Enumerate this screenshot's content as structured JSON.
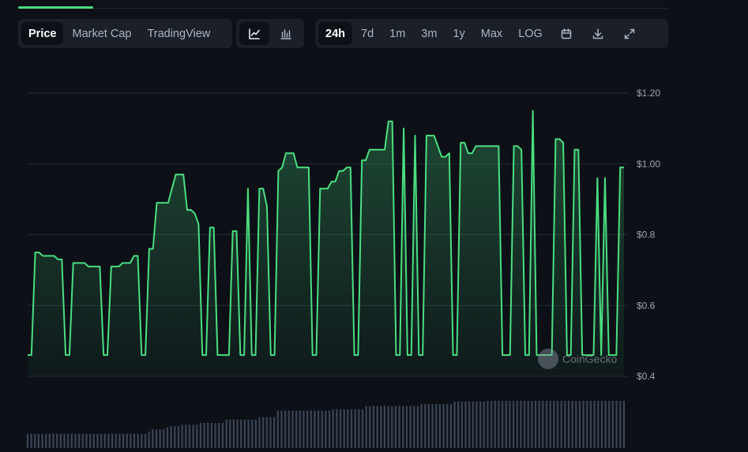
{
  "tabs": {
    "type": [
      {
        "label": "Price",
        "active": true
      },
      {
        "label": "Market Cap",
        "active": false
      },
      {
        "label": "TradingView",
        "active": false
      }
    ],
    "chart_icons": [
      {
        "icon": "line-chart-icon",
        "active": true
      },
      {
        "icon": "candlestick-chart-icon",
        "active": false
      }
    ],
    "ranges": [
      {
        "label": "24h",
        "active": true
      },
      {
        "label": "7d",
        "active": false
      },
      {
        "label": "1m",
        "active": false
      },
      {
        "label": "3m",
        "active": false
      },
      {
        "label": "1y",
        "active": false
      },
      {
        "label": "Max",
        "active": false
      },
      {
        "label": "LOG",
        "active": false
      }
    ],
    "tools": [
      "calendar-icon",
      "download-icon",
      "fullscreen-icon"
    ]
  },
  "watermark": "CoinGecko",
  "colors": {
    "accent": "#4ade80",
    "background": "#0d1117",
    "volume": "#3a4556"
  },
  "chart_data": {
    "type": "line",
    "title": "",
    "xlabel": "",
    "ylabel": "",
    "ylim": [
      0.4,
      1.2
    ],
    "y_ticks": [
      {
        "value": 1.2,
        "label": "$1.20"
      },
      {
        "value": 1.0,
        "label": "$1.00"
      },
      {
        "value": 0.8,
        "label": "$0.8"
      },
      {
        "value": 0.6,
        "label": "$0.6"
      },
      {
        "value": 0.4,
        "label": "$0.4"
      }
    ],
    "grid": true,
    "series": [
      {
        "values": [
          0.46,
          0.46,
          0.75,
          0.75,
          0.74,
          0.74,
          0.74,
          0.74,
          0.73,
          0.73,
          0.46,
          0.46,
          0.72,
          0.72,
          0.72,
          0.72,
          0.71,
          0.71,
          0.71,
          0.71,
          0.46,
          0.46,
          0.71,
          0.71,
          0.71,
          0.72,
          0.72,
          0.72,
          0.74,
          0.74,
          0.46,
          0.46,
          0.76,
          0.76,
          0.89,
          0.89,
          0.89,
          0.89,
          0.93,
          0.97,
          0.97,
          0.97,
          0.87,
          0.87,
          0.86,
          0.83,
          0.46,
          0.46,
          0.82,
          0.82,
          0.46,
          0.46,
          0.46,
          0.46,
          0.81,
          0.81,
          0.46,
          0.46,
          0.93,
          0.46,
          0.46,
          0.93,
          0.93,
          0.88,
          0.46,
          0.46,
          0.98,
          0.99,
          1.03,
          1.03,
          1.03,
          0.99,
          0.99,
          0.99,
          0.99,
          0.46,
          0.46,
          0.93,
          0.93,
          0.93,
          0.95,
          0.95,
          0.98,
          0.98,
          0.99,
          0.99,
          0.46,
          0.46,
          1.01,
          1.01,
          1.04,
          1.04,
          1.04,
          1.04,
          1.04,
          1.12,
          1.12,
          0.46,
          0.46,
          1.1,
          0.46,
          0.46,
          1.08,
          0.46,
          0.46,
          1.08,
          1.08,
          1.08,
          1.05,
          1.02,
          1.02,
          1.03,
          0.46,
          0.46,
          1.06,
          1.06,
          1.03,
          1.03,
          1.05,
          1.05,
          1.05,
          1.05,
          1.05,
          1.05,
          1.05,
          0.46,
          0.46,
          0.46,
          1.05,
          1.05,
          1.04,
          0.46,
          0.46,
          1.15,
          0.46,
          0.46,
          0.46,
          0.46,
          0.46,
          1.07,
          1.07,
          1.06,
          0.46,
          0.46,
          1.04,
          1.04,
          0.46,
          0.46,
          0.46,
          0.46,
          0.96,
          0.46,
          0.96,
          0.46,
          0.46,
          0.46,
          0.99,
          0.99
        ],
        "color": "#4ade80"
      }
    ],
    "volume": [
      0.22,
      0.22,
      0.22,
      0.22,
      0.22,
      0.22,
      0.22,
      0.22,
      0.22,
      0.22,
      0.22,
      0.22,
      0.22,
      0.22,
      0.22,
      0.22,
      0.22,
      0.22,
      0.22,
      0.22,
      0.22,
      0.22,
      0.22,
      0.22,
      0.22,
      0.22,
      0.22,
      0.22,
      0.22,
      0.22,
      0.22,
      0.22,
      0.22,
      0.25,
      0.29,
      0.29,
      0.29,
      0.29,
      0.32,
      0.34,
      0.34,
      0.34,
      0.36,
      0.36,
      0.36,
      0.36,
      0.36,
      0.39,
      0.39,
      0.39,
      0.39,
      0.39,
      0.39,
      0.39,
      0.44,
      0.44,
      0.44,
      0.44,
      0.44,
      0.44,
      0.44,
      0.44,
      0.44,
      0.48,
      0.48,
      0.48,
      0.48,
      0.48,
      0.58,
      0.58,
      0.58,
      0.58,
      0.58,
      0.58,
      0.58,
      0.58,
      0.58,
      0.58,
      0.58,
      0.58,
      0.58,
      0.58,
      0.58,
      0.6,
      0.6,
      0.6,
      0.6,
      0.6,
      0.6,
      0.6,
      0.6,
      0.6,
      0.65,
      0.65,
      0.65,
      0.65,
      0.65,
      0.65,
      0.65,
      0.65,
      0.65,
      0.65,
      0.65,
      0.65,
      0.65,
      0.65,
      0.65,
      0.68,
      0.68,
      0.68,
      0.68,
      0.68,
      0.68,
      0.68,
      0.68,
      0.68,
      0.72,
      0.72,
      0.72,
      0.72,
      0.72,
      0.72,
      0.72,
      0.72,
      0.72,
      0.73,
      0.73,
      0.73,
      0.73,
      0.73,
      0.73,
      0.73,
      0.73,
      0.73,
      0.73,
      0.73,
      0.73,
      0.73,
      0.73,
      0.73,
      0.73,
      0.73,
      0.73,
      0.73,
      0.73,
      0.73,
      0.73,
      0.73,
      0.73,
      0.73,
      0.73,
      0.73,
      0.73,
      0.73,
      0.73,
      0.73,
      0.73,
      0.73,
      0.73,
      0.73,
      0.73,
      0.73,
      0.73
    ]
  }
}
